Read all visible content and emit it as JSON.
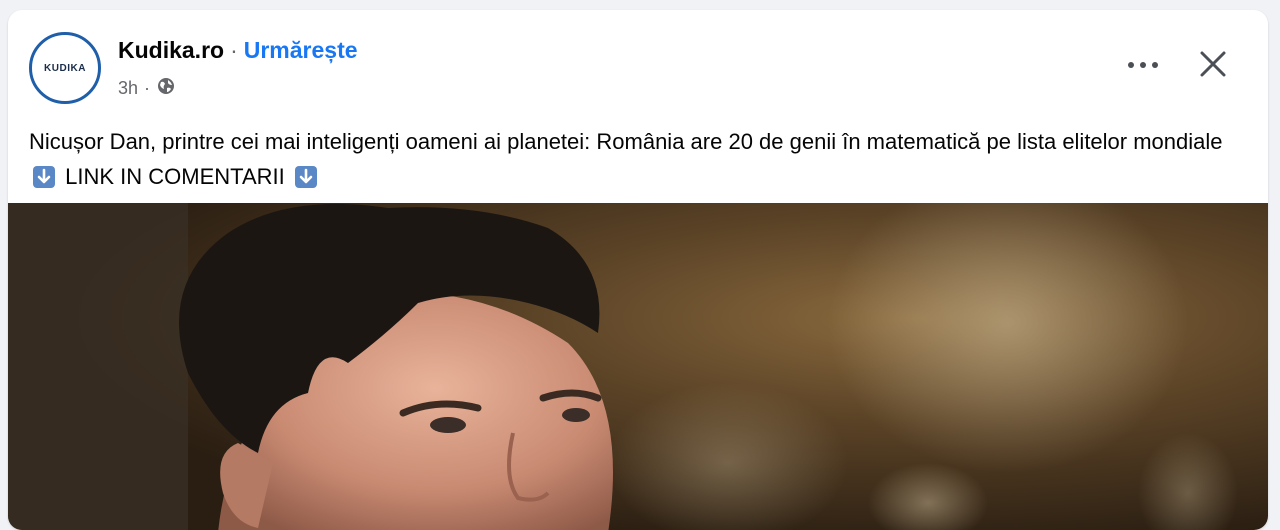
{
  "post": {
    "page_name": "Kudika.ro",
    "separator": "·",
    "follow_label": "Urmărește",
    "timestamp": "3h",
    "avatar_text": "KUDIKA",
    "text_part1": "Nicușor Dan, printre cei mai inteligenți oameni ai planetei: România are 20 de genii în matematică pe lista elitelor mondiale",
    "text_part2": "LINK IN COMENTARII",
    "icons": {
      "audience": "globe-icon",
      "more": "more-options-icon",
      "close": "close-icon",
      "emoji": "down-arrow-emoji-icon"
    }
  },
  "colors": {
    "accent": "#1877f2",
    "avatar_ring": "#1f5ea8",
    "emoji_box": "#5a87c6"
  }
}
